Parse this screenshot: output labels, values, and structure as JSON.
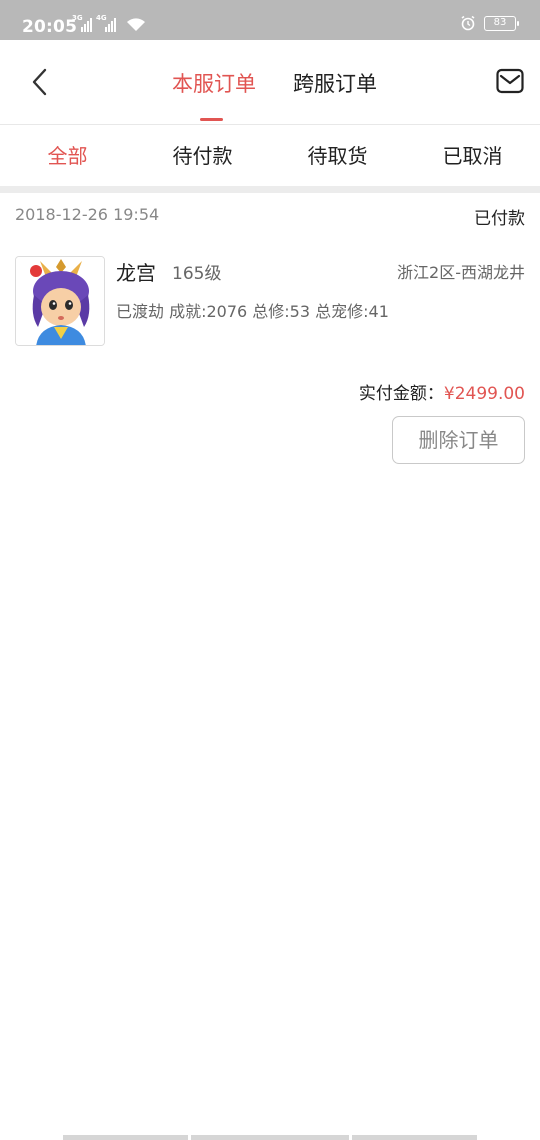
{
  "status_bar": {
    "time": "20:05",
    "sim1_label": "3G",
    "sim2_label": "4G",
    "battery": "83"
  },
  "header": {
    "tabs": [
      {
        "label": "本服订单",
        "active": true
      },
      {
        "label": "跨服订单",
        "active": false
      }
    ],
    "back_icon": "chevron-left-icon",
    "mail_icon": "mail-icon"
  },
  "filters": [
    {
      "label": "全部",
      "active": true
    },
    {
      "label": "待付款",
      "active": false
    },
    {
      "label": "待取货",
      "active": false
    },
    {
      "label": "已取消",
      "active": false
    }
  ],
  "order": {
    "date": "2018-12-26 19:54",
    "status": "已付款",
    "character_name": "龙宫",
    "level": "165级",
    "server": "浙江2区-西湖龙井",
    "stats": "已渡劫 成就:2076 总修:53 总宠修:41",
    "paid_label": "实付金额：",
    "paid_amount": "¥2499.00",
    "delete_label": "删除订单"
  },
  "colors": {
    "accent": "#e15552",
    "status_bar": "#b8b8b8",
    "divider": "#ececec"
  }
}
